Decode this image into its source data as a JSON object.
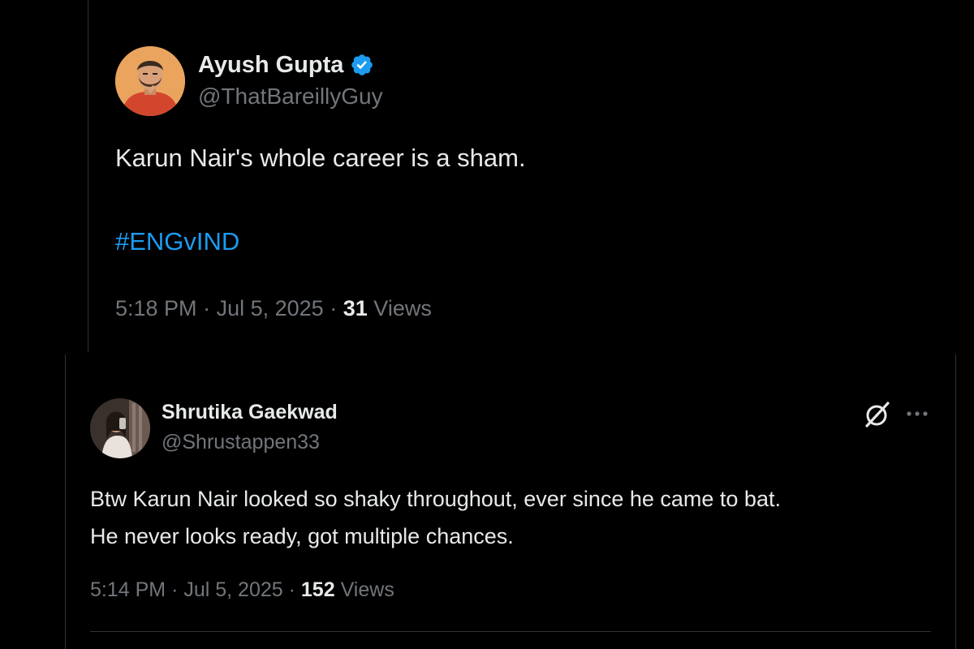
{
  "tweet_main": {
    "author_name": "Ayush Gupta",
    "author_handle": "@ThatBareillyGuy",
    "verified": true,
    "text": "Karun Nair's whole career is a sham.",
    "hashtag": "#ENGvIND",
    "time": "5:18 PM",
    "date": "Jul 5, 2025",
    "views_count": "31",
    "views_label": "Views",
    "separator": "·"
  },
  "tweet_reply": {
    "author_name": "Shrutika Gaekwad",
    "author_handle": "@Shrustappen33",
    "text_lines": [
      "Btw Karun Nair looked so shaky throughout, ever since he came to bat.",
      "He never looks ready, got multiple chances."
    ],
    "time": "5:14 PM",
    "date": "Jul 5, 2025",
    "views_count": "152",
    "views_label": "Views",
    "separator": "·",
    "icons": [
      "grok-icon",
      "more-icon"
    ]
  },
  "colors": {
    "background": "#000000",
    "text_primary": "#e7e9ea",
    "text_secondary": "#71767b",
    "link": "#1d9bf0",
    "border": "#2f3336"
  }
}
